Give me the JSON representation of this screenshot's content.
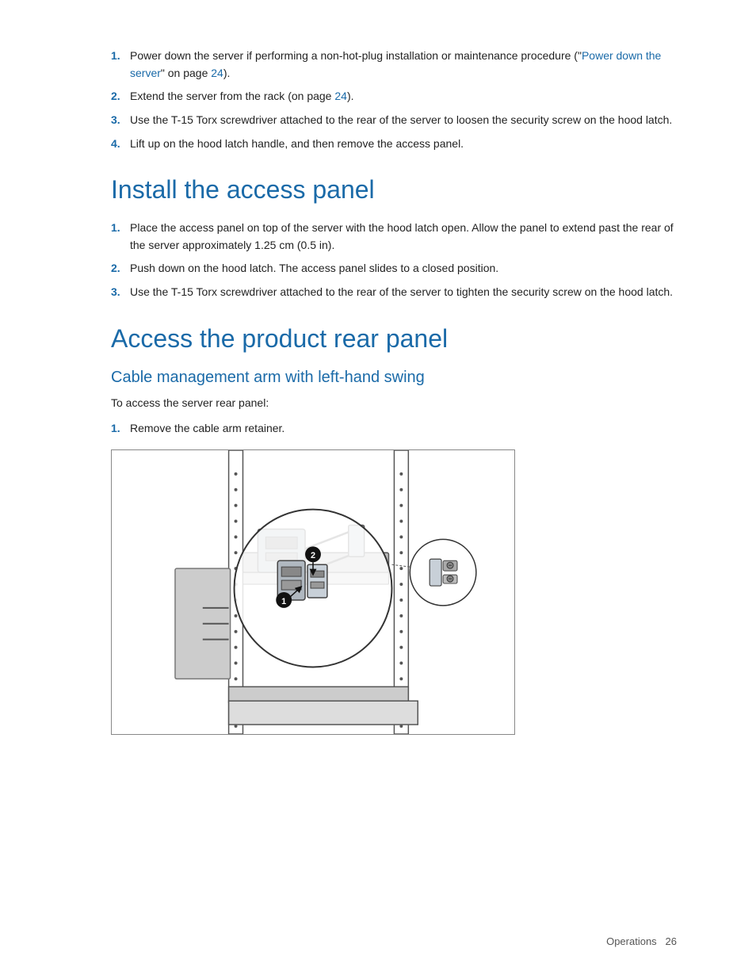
{
  "page": {
    "footer": {
      "section": "Operations",
      "page_number": "26"
    }
  },
  "intro_list": {
    "items": [
      {
        "number": "1.",
        "text_before_link": "Power down the server if performing a non-hot-plug installation or maintenance procedure (\"",
        "link_text": "Power down the server",
        "text_after_link": "\" on page 24)."
      },
      {
        "number": "2.",
        "text": "Extend the server from the rack (on page ",
        "link_page": "24",
        "text_end": ")."
      },
      {
        "number": "3.",
        "text": "Use the T-15 Torx screwdriver attached to the rear of the server to loosen the security screw on the hood latch."
      },
      {
        "number": "4.",
        "text": "Lift up on the hood latch handle, and then remove the access panel."
      }
    ]
  },
  "install_panel": {
    "heading": "Install the access panel",
    "items": [
      {
        "number": "1.",
        "text": "Place the access panel on top of the server with the hood latch open. Allow the panel to extend past the rear of the server approximately 1.25 cm (0.5 in)."
      },
      {
        "number": "2.",
        "text": "Push down on the hood latch. The access panel slides to a closed position."
      },
      {
        "number": "3.",
        "text": "Use the T-15 Torx screwdriver attached to the rear of the server to tighten the security screw on the hood latch."
      }
    ]
  },
  "access_rear": {
    "heading": "Access the product rear panel",
    "subheading": "Cable management arm with left-hand swing",
    "intro": "To access the server rear panel:",
    "items": [
      {
        "number": "1.",
        "text": "Remove the cable arm retainer."
      }
    ]
  }
}
